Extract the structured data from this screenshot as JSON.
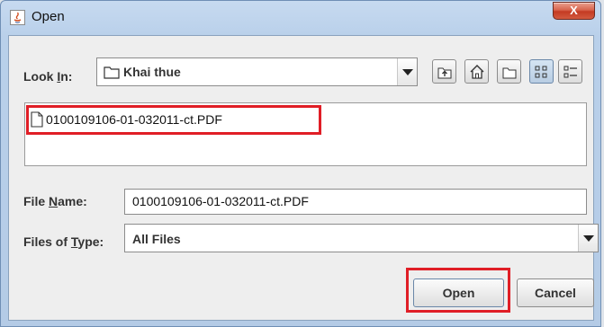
{
  "window": {
    "title": "Open",
    "close_label": "X"
  },
  "look_in": {
    "label_pre": "Look ",
    "label_mnemonic": "I",
    "label_post": "n:",
    "value": "Khai thue"
  },
  "toolbar": {
    "buttons": [
      "up-one-level-icon",
      "home-icon",
      "new-folder-icon",
      "list-view-icon",
      "details-view-icon"
    ],
    "selected": "list-view-icon"
  },
  "file_list": {
    "items": [
      {
        "name": "0100109106-01-032011-ct.PDF",
        "icon": "document-icon"
      }
    ]
  },
  "file_name": {
    "label_pre": "File ",
    "label_mnemonic": "N",
    "label_post": "ame:",
    "value": "0100109106-01-032011-ct.PDF"
  },
  "file_type": {
    "label_pre": "Files of ",
    "label_mnemonic": "T",
    "label_post": "ype:",
    "value": "All Files"
  },
  "buttons": {
    "open": "Open",
    "cancel": "Cancel"
  },
  "colors": {
    "highlight": "#e01e26",
    "title_bar": "#c7daf0",
    "close_button": "#c43b23"
  }
}
